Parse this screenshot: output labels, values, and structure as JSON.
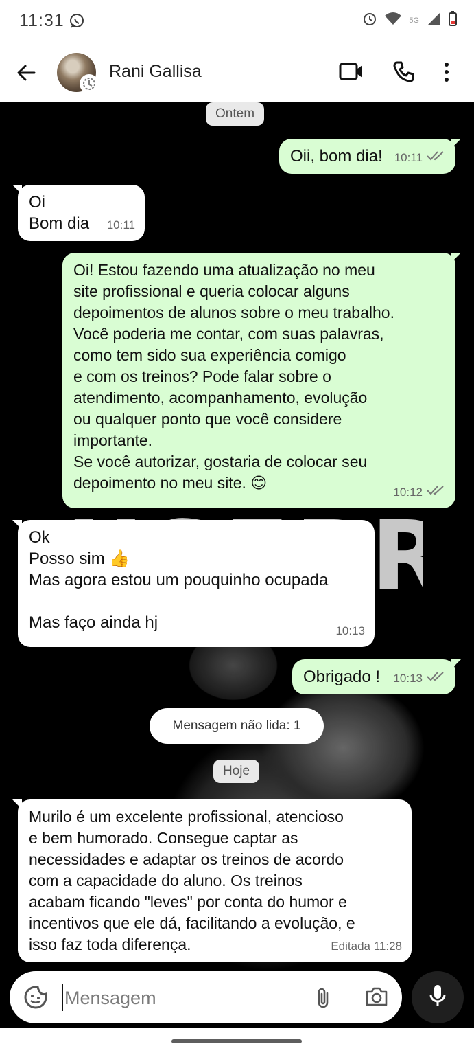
{
  "status_bar": {
    "time": "11:31",
    "network": "5G"
  },
  "header": {
    "back_icon": "arrow-left-icon",
    "contact_name": "Rani Gallisa",
    "video_icon": "video-call-icon",
    "call_icon": "phone-icon",
    "menu_icon": "more-vertical-icon"
  },
  "wallpaper": {
    "text": "USEPREME"
  },
  "chat": {
    "date_yesterday": "Ontem",
    "date_today": "Hoje",
    "unread_label": "Mensagem não lida: 1",
    "messages": [
      {
        "direction": "out",
        "text": "Oii, bom dia!",
        "time": "10:11",
        "read": true
      },
      {
        "direction": "in",
        "text": "Oi\nBom dia",
        "time": "10:11"
      },
      {
        "direction": "out",
        "text": "Oi! Estou fazendo uma atualização no meu\nsite profissional e queria colocar alguns\ndepoimentos de alunos sobre o meu trabalho.\nVocê poderia me contar, com suas palavras,\ncomo tem sido sua experiência comigo\ne com os treinos? Pode falar sobre o\natendimento, acompanhamento, evolução\nou qualquer ponto que você considere\nimportante.\nSe você autorizar, gostaria de colocar seu\ndepoimento no meu site. 😊",
        "time": "10:12",
        "read": true
      },
      {
        "direction": "in",
        "text": "Ok\nPosso sim 👍\nMas agora estou um pouquinho ocupada\n\nMas faço ainda hj",
        "time": "10:13"
      },
      {
        "direction": "out",
        "text": "Obrigado !",
        "time": "10:13",
        "read": true
      },
      {
        "direction": "in",
        "text": "Murilo é um excelente profissional, atencioso\ne bem humorado. Consegue captar as\nnecessidades e adaptar os treinos de acordo\ncom a capacidade do aluno. Os treinos\nacabam ficando \"leves\" por conta do humor e\nincentivos que ele dá, facilitando a evolução, e\nisso faz toda diferença.",
        "time": "Editada 11:28"
      }
    ]
  },
  "composer": {
    "placeholder": "Mensagem",
    "emoji_icon": "sticker-emoji-icon",
    "attach_icon": "paperclip-icon",
    "camera_icon": "camera-icon",
    "mic_icon": "microphone-icon"
  },
  "colors": {
    "outgoing_bubble": "#d9fdd3",
    "incoming_bubble": "#ffffff",
    "chat_background": "#000000",
    "read_ticks": "#777777"
  }
}
